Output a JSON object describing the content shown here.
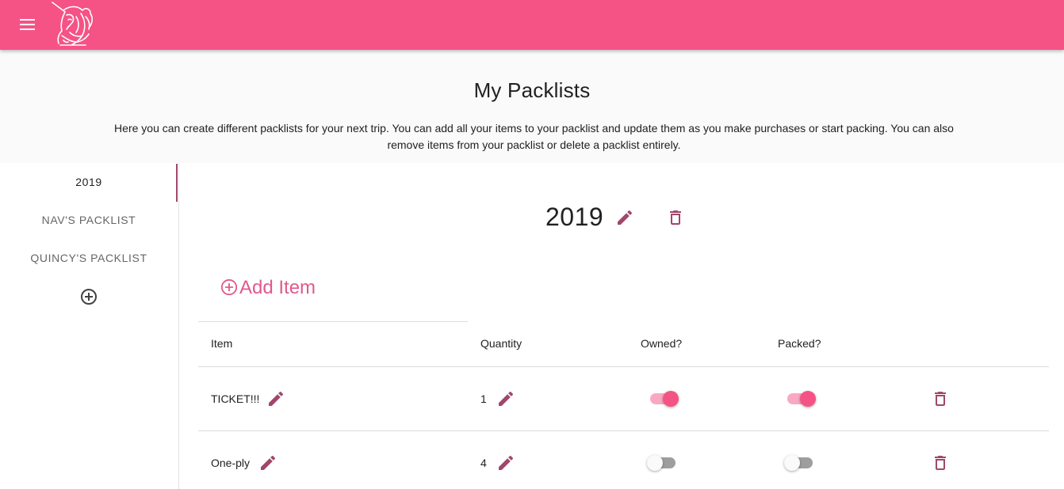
{
  "colors": {
    "brand": "#f55385",
    "accent": "#a0476c",
    "add_item": "#e05a8c",
    "switch_on_track": "#f9a8c3",
    "switch_off_track": "#9e9e9e"
  },
  "header": {
    "menu_icon": "menu-icon",
    "logo_icon": "unicorn-logo-icon"
  },
  "hero": {
    "title": "My Packlists",
    "description": "Here you can create different packlists for your next trip. You can add all your items to your packlist and update them as you make purchases or start packing. You can also remove items from your packlist or delete a packlist entirely."
  },
  "sidebar": {
    "items": [
      {
        "label": "2019",
        "active": true
      },
      {
        "label": "Nav's Packlist",
        "active": false
      },
      {
        "label": "Quincy's Packlist",
        "active": false
      }
    ],
    "add_icon": "add-circle-icon"
  },
  "packlist": {
    "title": "2019",
    "edit_icon": "pencil-icon",
    "delete_icon": "trash-icon",
    "add_item_label": "Add Item",
    "columns": [
      "Item",
      "Quantity",
      "Owned?",
      "Packed?"
    ],
    "rows": [
      {
        "item": "TICKET!!!",
        "quantity": "1",
        "owned": true,
        "packed": true
      },
      {
        "item": "One-ply",
        "quantity": "4",
        "owned": false,
        "packed": false
      }
    ]
  }
}
